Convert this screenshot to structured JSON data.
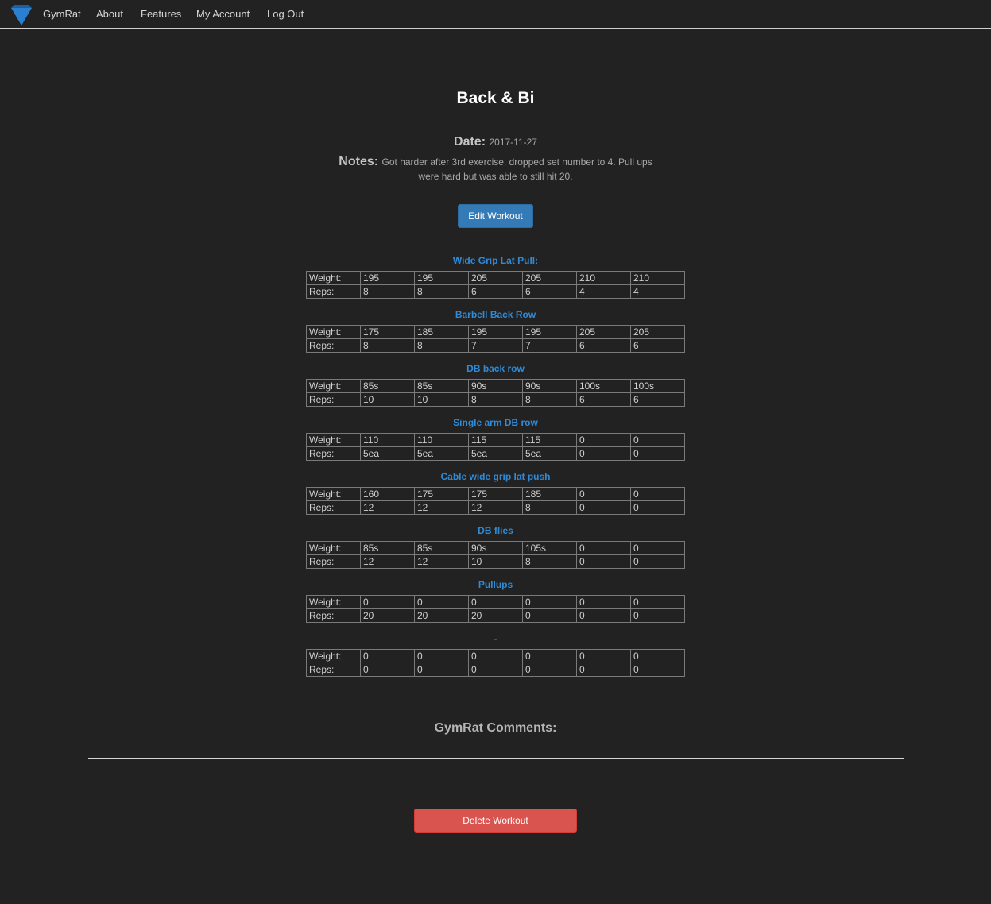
{
  "nav": {
    "brand": "GymRat",
    "links": [
      "About",
      "Features",
      "My Account",
      "Log Out"
    ]
  },
  "workout": {
    "title": "Back & Bi",
    "date_label": "Date:",
    "date": "2017-11-27",
    "notes_label": "Notes:",
    "notes": "Got harder after 3rd exercise, dropped set number to 4. Pull ups were hard but was able to still hit 20.",
    "edit_label": "Edit Workout"
  },
  "row_labels": {
    "weight": "Weight:",
    "reps": "Reps:"
  },
  "exercises": [
    {
      "name": "Wide Grip Lat Pull:",
      "weights": [
        "195",
        "195",
        "205",
        "205",
        "210",
        "210"
      ],
      "reps": [
        "8",
        "8",
        "6",
        "6",
        "4",
        "4"
      ]
    },
    {
      "name": "Barbell Back Row",
      "weights": [
        "175",
        "185",
        "195",
        "195",
        "205",
        "205"
      ],
      "reps": [
        "8",
        "8",
        "7",
        "7",
        "6",
        "6"
      ]
    },
    {
      "name": "DB back row",
      "weights": [
        "85s",
        "85s",
        "90s",
        "90s",
        "100s",
        "100s"
      ],
      "reps": [
        "10",
        "10",
        "8",
        "8",
        "6",
        "6"
      ]
    },
    {
      "name": "Single arm DB row",
      "weights": [
        "110",
        "110",
        "115",
        "115",
        "0",
        "0"
      ],
      "reps": [
        "5ea",
        "5ea",
        "5ea",
        "5ea",
        "0",
        "0"
      ]
    },
    {
      "name": "Cable wide grip lat push",
      "weights": [
        "160",
        "175",
        "175",
        "185",
        "0",
        "0"
      ],
      "reps": [
        "12",
        "12",
        "12",
        "8",
        "0",
        "0"
      ]
    },
    {
      "name": "DB flies",
      "weights": [
        "85s",
        "85s",
        "90s",
        "105s",
        "0",
        "0"
      ],
      "reps": [
        "12",
        "12",
        "10",
        "8",
        "0",
        "0"
      ]
    },
    {
      "name": "Pullups",
      "weights": [
        "0",
        "0",
        "0",
        "0",
        "0",
        "0"
      ],
      "reps": [
        "20",
        "20",
        "20",
        "0",
        "0",
        "0"
      ]
    },
    {
      "name": "-",
      "weights": [
        "0",
        "0",
        "0",
        "0",
        "0",
        "0"
      ],
      "reps": [
        "0",
        "0",
        "0",
        "0",
        "0",
        "0"
      ]
    }
  ],
  "comments_title": "GymRat Comments:",
  "delete_label": "Delete Workout",
  "colors": {
    "background": "#222222",
    "accent": "#337ab7",
    "link": "#2f8bd8",
    "danger": "#d9534f"
  }
}
